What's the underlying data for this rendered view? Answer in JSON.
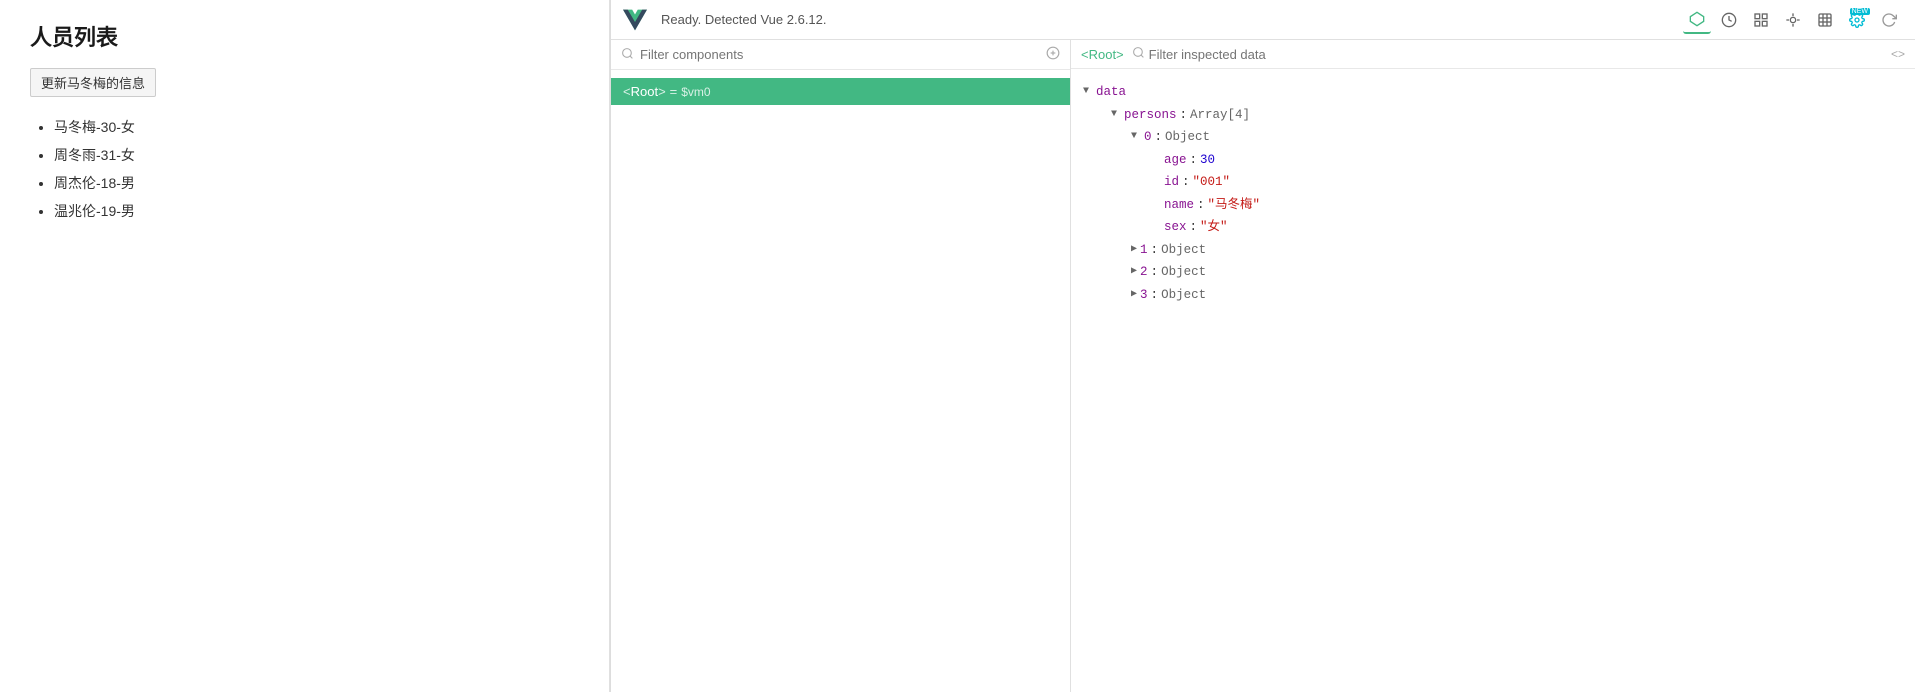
{
  "app": {
    "title": "人员列表",
    "update_button": "更新马冬梅的信息",
    "persons": [
      "马冬梅-30-女",
      "周冬雨-31-女",
      "周杰伦-18-男",
      "温兆伦-19-男"
    ]
  },
  "devtools": {
    "status": "Ready. Detected Vue 2.6.12.",
    "icons": {
      "components": "⬡",
      "timeline": "⏱",
      "grid": "⊞",
      "router": "◈",
      "store": "▦",
      "settings": "⚙",
      "new": "NEW",
      "refresh": "↻"
    },
    "component_search_placeholder": "Filter components",
    "inspector_filter_placeholder": "Filter inspected data"
  },
  "component_tree": {
    "items": [
      {
        "tag": "Root",
        "equals": "=",
        "vm": "$vm0",
        "selected": true
      }
    ]
  },
  "inspector": {
    "breadcrumb": "<Root>",
    "data": {
      "section": "data",
      "persons_key": "persons",
      "persons_type": "Array[4]",
      "items": [
        {
          "index": "0",
          "type": "Object",
          "expanded": true,
          "fields": [
            {
              "key": "age",
              "value": "30",
              "value_type": "number"
            },
            {
              "key": "id",
              "value": "\"001\"",
              "value_type": "string"
            },
            {
              "key": "name",
              "value": "\"马冬梅\"",
              "value_type": "string"
            },
            {
              "key": "sex",
              "value": "\"女\"",
              "value_type": "string"
            }
          ]
        },
        {
          "index": "1",
          "type": "Object",
          "expanded": false
        },
        {
          "index": "2",
          "type": "Object",
          "expanded": false
        },
        {
          "index": "3",
          "type": "Object",
          "expanded": false
        }
      ]
    }
  }
}
